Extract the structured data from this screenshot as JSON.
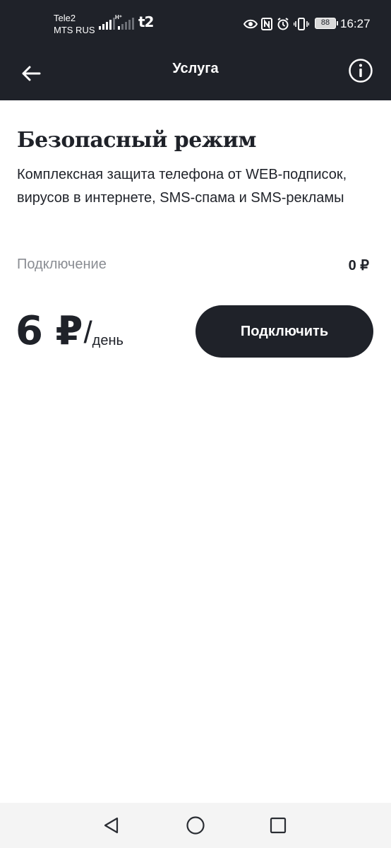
{
  "status_bar": {
    "carrier_1": "Tele2",
    "carrier_2": "MTS RUS",
    "signal_tag_1": "H⁺",
    "signal_tag_2": "",
    "network_logo": "t2",
    "icons": [
      "eye-icon",
      "nfc-icon",
      "alarm-icon",
      "vibrate-icon"
    ],
    "battery": "88",
    "time": "16:27"
  },
  "app_bar": {
    "title": "Услуга",
    "back_icon": "arrow-left-icon",
    "info_icon": "info-circle-icon"
  },
  "service": {
    "title": "Безопасный режим",
    "description": "Комплексная защита телефона от WEB-подписок, вирусов в интернете, SMS-спама и SMS-рекламы",
    "connection_fee_label": "Подключение",
    "connection_fee_value": "0 ₽",
    "price_amount": "6 ₽",
    "price_separator": "/",
    "price_period": "день",
    "connect_button": "Подключить"
  },
  "nav_bar": {
    "icons": [
      "back-triangle-icon",
      "home-circle-icon",
      "recents-square-icon"
    ]
  },
  "colors": {
    "header_bg": "#1f2229",
    "text_primary": "#1f2229",
    "text_secondary": "#8a8d93",
    "background": "#ffffff",
    "nav_bar_bg": "#f4f4f4"
  }
}
